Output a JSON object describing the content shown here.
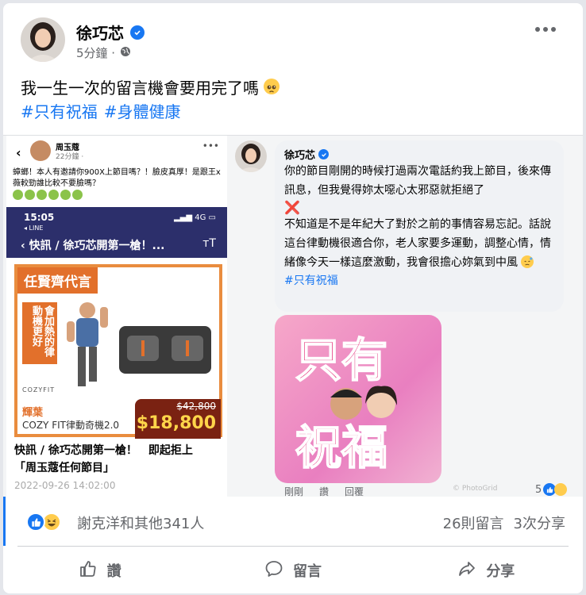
{
  "post": {
    "author": "徐巧芯",
    "time": "5分鐘 ·",
    "text": "我一生一次的留言機會要用完了嗎",
    "hashtags": [
      "#只有祝福",
      "#身體健康"
    ]
  },
  "left_screenshot": {
    "author": "周玉蔻",
    "time": "22分鐘 ·",
    "text": "蟑螂！本人有邀請你900X上節目嗎？！臉皮真厚！是跟王x薇較勁誰比較不要臉嗎？",
    "phone": {
      "time": "15:05",
      "carrier": "◂ LINE",
      "status": "4G",
      "title": "快訊 / 徐巧芯開第一槍！..."
    },
    "ad": {
      "tag": "任賢齊代言",
      "vertical_text": "會加熱的律動機更好",
      "logo": "COZYFIT",
      "old_price": "$42,800",
      "new_price": "$18,800",
      "brand": "輝葉",
      "model": "COZY FIT律動奇機2.0"
    },
    "headline_line1": "快訊 / 徐巧芯開第一槍！　即起拒上",
    "headline_line2": "「周玉蔻任何節目」",
    "date": "2022-09-26 14:02:00"
  },
  "comment": {
    "author": "徐巧芯",
    "para1": "你的節目剛開的時候打過兩次電話約我上節目，後來傳訊息，但我覺得妳太噁心太邪惡就拒絕了",
    "cross": "❌",
    "para2": "不知道是不是年紀大了對於之前的事情容易忘記。話說這台律動機很適合你，老人家要多運動，調整心情，情緒像今天一樣這麼激動，我會很擔心妳氣到中風",
    "hashtag": "#只有祝福",
    "sticker_line1": "只有",
    "sticker_line2": "祝福",
    "actions": [
      "剛剛",
      "讚",
      "回覆"
    ],
    "watermark": "© PhotoGrid",
    "reaction_count": "5"
  },
  "reactions": {
    "names": "謝克洋和其他341人",
    "comments": "26則留言",
    "shares": "3次分享"
  },
  "action_bar": {
    "like": "讚",
    "comment": "留言",
    "share": "分享"
  }
}
